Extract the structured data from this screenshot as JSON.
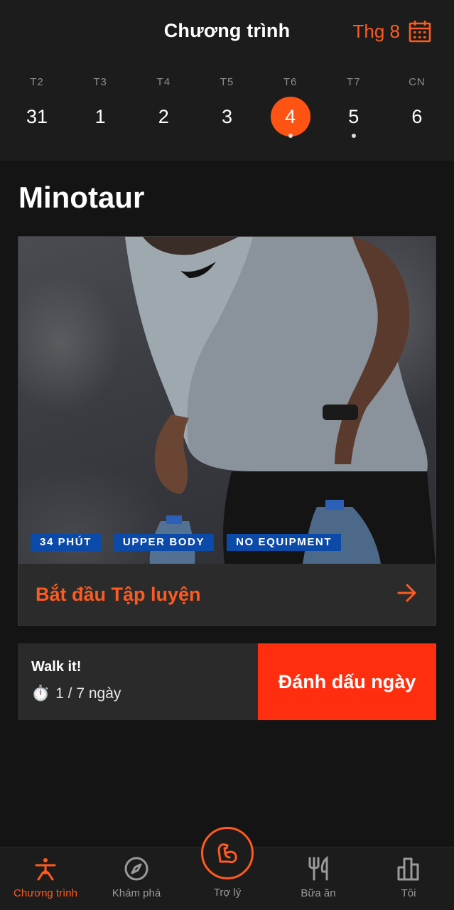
{
  "header": {
    "title": "Chương trình",
    "month_label": "Thg 8"
  },
  "week": [
    {
      "name": "T2",
      "num": "31",
      "active": false,
      "dot": false
    },
    {
      "name": "T3",
      "num": "1",
      "active": false,
      "dot": false
    },
    {
      "name": "T4",
      "num": "2",
      "active": false,
      "dot": false
    },
    {
      "name": "T5",
      "num": "3",
      "active": false,
      "dot": false
    },
    {
      "name": "T6",
      "num": "4",
      "active": true,
      "dot": true
    },
    {
      "name": "T7",
      "num": "5",
      "active": false,
      "dot": true
    },
    {
      "name": "CN",
      "num": "6",
      "active": false,
      "dot": false
    }
  ],
  "program": {
    "title": "Minotaur",
    "tags": [
      "34 PHÚT",
      "UPPER BODY",
      "NO EQUIPMENT"
    ],
    "start_label": "Bắt đầu Tập luyện"
  },
  "challenge": {
    "name": "Walk it!",
    "progress_icon": "⏱️",
    "progress": "1 / 7 ngày",
    "mark_button": "Đánh dấu ngày"
  },
  "nav": {
    "items": [
      {
        "label": "Chương trình",
        "icon": "yoga-pose-icon",
        "active": true
      },
      {
        "label": "Khám phá",
        "icon": "compass-icon",
        "active": false
      },
      {
        "label": "Trợ lý",
        "icon": "flexed-arm-icon",
        "active": false
      },
      {
        "label": "Bữa ăn",
        "icon": "fork-knife-icon",
        "active": false
      },
      {
        "label": "Tôi",
        "icon": "bar-chart-icon",
        "active": false
      }
    ]
  },
  "colors": {
    "accent": "#ff5a1f",
    "mark_button": "#ff2e0f",
    "tag_bg": "#0b4aa8",
    "background": "#141414"
  }
}
